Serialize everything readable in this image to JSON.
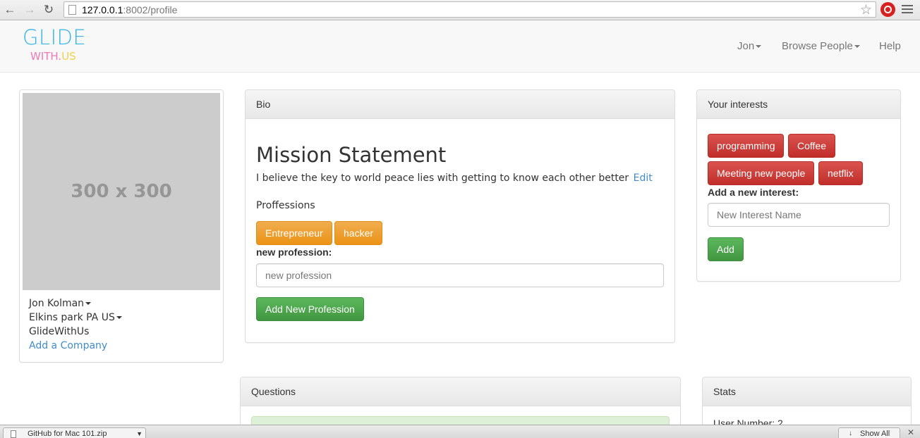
{
  "browser": {
    "url_host": "127.0.0.1",
    "url_rest": ":8002/profile",
    "back_icon": "back-arrow-icon",
    "forward_icon": "forward-arrow-icon",
    "reload_icon": "reload-icon"
  },
  "navbar": {
    "logo_top": "GLIDE",
    "logo_bottom_a": "WITH.",
    "logo_bottom_b": "US",
    "links": {
      "user": "Jon",
      "browse": "Browse People",
      "help": "Help"
    }
  },
  "profile_card": {
    "image_text": "300 x 300",
    "name": "Jon Kolman",
    "location": "Elkins park PA US",
    "company": "GlideWithUs",
    "add_company": "Add a Company"
  },
  "bio": {
    "heading": "Bio",
    "mission_title": "Mission Statement",
    "mission_text": "I believe the key to world peace lies with getting to know each other better",
    "edit_link": "Edit",
    "professions_title": "Proffessions",
    "professions": [
      "Entrepreneur",
      "hacker"
    ],
    "new_profession_label": "new profession:",
    "new_profession_placeholder": "new profession",
    "add_profession_button": "Add New Profession"
  },
  "interests": {
    "heading": "Your interests",
    "tags": [
      "programming",
      "Coffee",
      "Meeting new people",
      "netflix"
    ],
    "add_label": "Add a new interest:",
    "input_placeholder": "New Interest Name",
    "add_button": "Add"
  },
  "questions": {
    "heading": "Questions"
  },
  "stats": {
    "heading": "Stats",
    "user_number": "User Number: 2"
  },
  "download_shelf": {
    "item": "GitHub for Mac 101.zip",
    "show_all": "Show All"
  },
  "colors": {
    "accent_blue": "#428bca",
    "warning": "#f0ad4e",
    "danger": "#d9534f",
    "success": "#5cb85c",
    "logo_blue": "#33b5e5",
    "logo_pink": "#f07ab2",
    "logo_yellow": "#f4cf4a"
  }
}
